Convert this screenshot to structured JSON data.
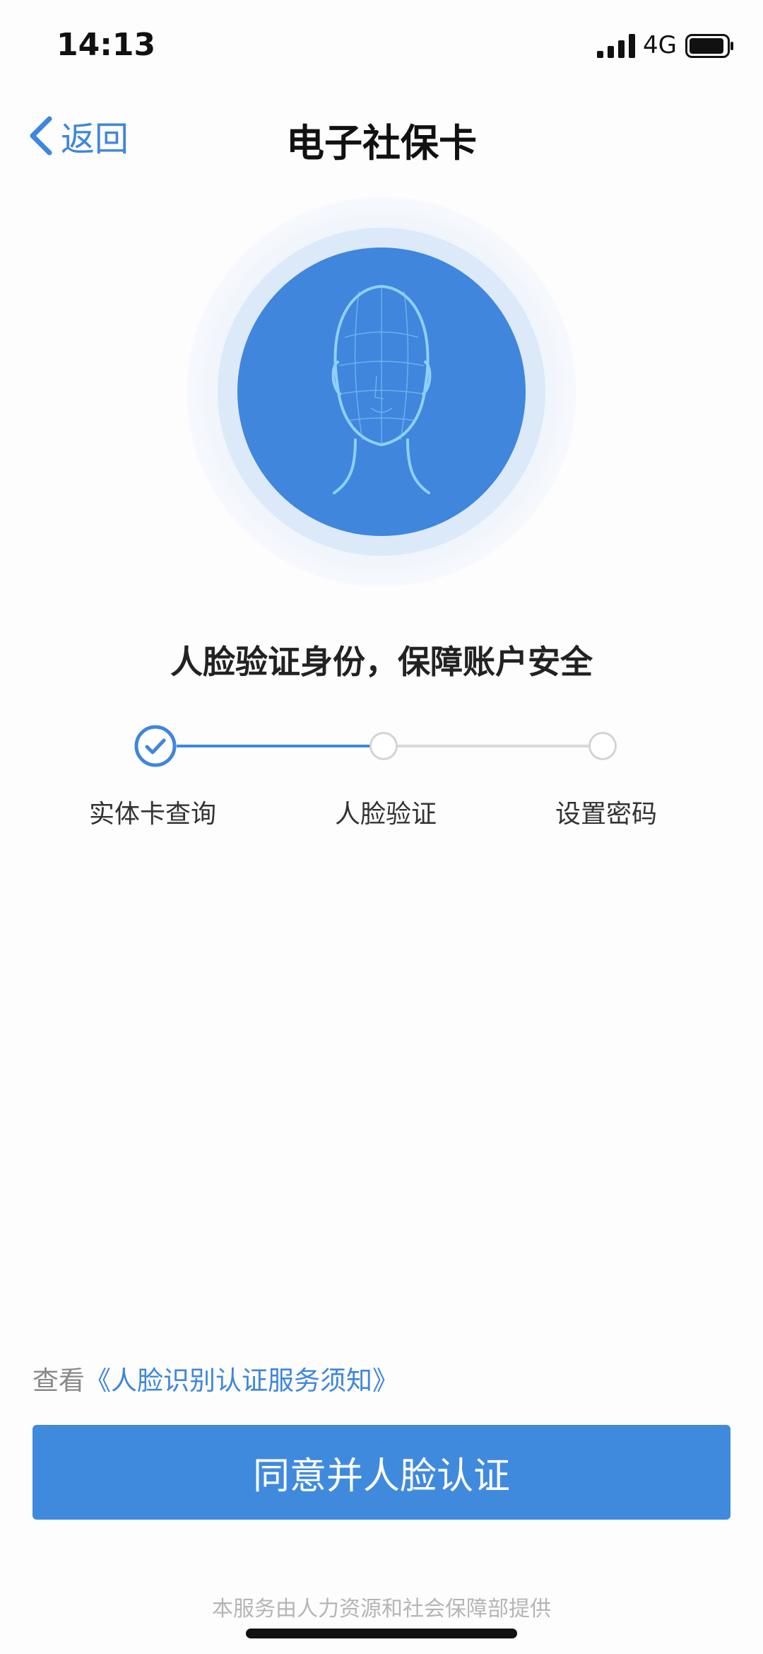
{
  "status_bar": {
    "time": "14:13",
    "network": "4G"
  },
  "nav": {
    "back_label": "返回",
    "title": "电子社保卡"
  },
  "hero": {
    "icon": "face-scan-icon"
  },
  "headline": "人脸验证身份，保障账户安全",
  "steps": [
    {
      "label": "实体卡查询",
      "state": "done"
    },
    {
      "label": "人脸验证",
      "state": "pending"
    },
    {
      "label": "设置密码",
      "state": "pending"
    }
  ],
  "notice": {
    "prefix": "查看",
    "link": "《人脸识别认证服务须知》"
  },
  "cta_label": "同意并人脸认证",
  "footer": "本服务由人力资源和社会保障部提供",
  "colors": {
    "accent": "#3f86dc",
    "button": "#408ade",
    "inactive": "#d9d9d9"
  }
}
